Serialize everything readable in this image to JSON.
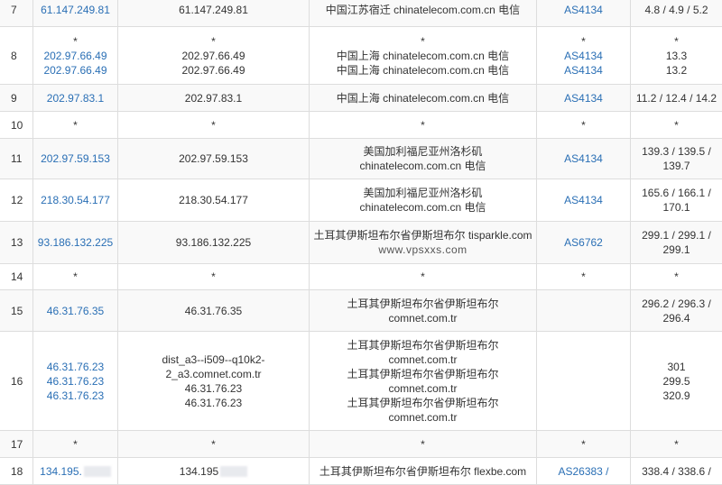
{
  "rows": [
    {
      "hop": "7",
      "ips": [
        "61.147.249.81"
      ],
      "hosts": [
        "61.147.249.81"
      ],
      "locs": [
        "中国江苏宿迁 chinatelecom.com.cn 电信"
      ],
      "asns": [
        "AS4134"
      ],
      "rtts": [
        "4.8 / 4.9 / 5.2"
      ]
    },
    {
      "hop": "8",
      "ips": [
        "*",
        "202.97.66.49",
        "202.97.66.49"
      ],
      "hosts": [
        "*",
        "202.97.66.49",
        "202.97.66.49"
      ],
      "locs": [
        "*",
        "中国上海 chinatelecom.com.cn 电信",
        "中国上海 chinatelecom.com.cn 电信"
      ],
      "asns": [
        "*",
        "AS4134",
        "AS4134"
      ],
      "rtts": [
        "*",
        "13.3",
        "13.2"
      ]
    },
    {
      "hop": "9",
      "ips": [
        "202.97.83.1"
      ],
      "hosts": [
        "202.97.83.1"
      ],
      "locs": [
        "中国上海 chinatelecom.com.cn 电信"
      ],
      "asns": [
        "AS4134"
      ],
      "rtts": [
        "11.2 / 12.4 / 14.2"
      ]
    },
    {
      "hop": "10",
      "ips": [
        "*"
      ],
      "hosts": [
        "*"
      ],
      "locs": [
        "*"
      ],
      "asns": [
        "*"
      ],
      "rtts": [
        "*"
      ]
    },
    {
      "hop": "11",
      "ips": [
        "202.97.59.153"
      ],
      "hosts": [
        "202.97.59.153"
      ],
      "locs": [
        "美国加利福尼亚州洛杉矶",
        "chinatelecom.com.cn 电信"
      ],
      "asns": [
        "AS4134"
      ],
      "rtts": [
        "139.3 / 139.5 /",
        "139.7"
      ]
    },
    {
      "hop": "12",
      "ips": [
        "218.30.54.177"
      ],
      "hosts": [
        "218.30.54.177"
      ],
      "locs": [
        "美国加利福尼亚州洛杉矶",
        "chinatelecom.com.cn 电信"
      ],
      "asns": [
        "AS4134"
      ],
      "rtts": [
        "165.6 / 166.1 /",
        "170.1"
      ]
    },
    {
      "hop": "13",
      "ips": [
        "93.186.132.225"
      ],
      "hosts": [
        "93.186.132.225"
      ],
      "locs": [
        "土耳其伊斯坦布尔省伊斯坦布尔 tisparkle.com"
      ],
      "watermark": "www.vpsxxs.com",
      "asns": [
        "AS6762"
      ],
      "rtts": [
        "299.1 / 299.1 /",
        "299.1"
      ]
    },
    {
      "hop": "14",
      "ips": [
        "*"
      ],
      "hosts": [
        "*"
      ],
      "locs": [
        "*"
      ],
      "asns": [
        "*"
      ],
      "rtts": [
        "*"
      ]
    },
    {
      "hop": "15",
      "ips": [
        "46.31.76.35"
      ],
      "hosts": [
        "46.31.76.35"
      ],
      "locs": [
        "土耳其伊斯坦布尔省伊斯坦布尔",
        "comnet.com.tr"
      ],
      "asns": [],
      "rtts": [
        "296.2 / 296.3 /",
        "296.4"
      ]
    },
    {
      "hop": "16",
      "ips": [
        "46.31.76.23",
        "46.31.76.23",
        "46.31.76.23"
      ],
      "hosts": [
        "dist_a3--i509--q10k2-",
        "2_a3.comnet.com.tr",
        "46.31.76.23",
        "46.31.76.23"
      ],
      "locs": [
        "土耳其伊斯坦布尔省伊斯坦布尔",
        "comnet.com.tr",
        "土耳其伊斯坦布尔省伊斯坦布尔",
        "comnet.com.tr",
        "土耳其伊斯坦布尔省伊斯坦布尔",
        "comnet.com.tr"
      ],
      "asns": [],
      "rtts": [
        "301",
        "299.5",
        "320.9"
      ]
    },
    {
      "hop": "17",
      "ips": [
        "*"
      ],
      "hosts": [
        "*"
      ],
      "locs": [
        "*"
      ],
      "asns": [
        "*"
      ],
      "rtts": [
        "*"
      ]
    },
    {
      "hop": "18",
      "ips": [
        "134.195."
      ],
      "hosts": [
        "134.195"
      ],
      "locs": [
        "土耳其伊斯坦布尔省伊斯坦布尔 flexbe.com"
      ],
      "asns": [
        "AS26383 /"
      ],
      "rtts": [
        "338.4 / 338.6 /"
      ],
      "masked": true
    }
  ]
}
